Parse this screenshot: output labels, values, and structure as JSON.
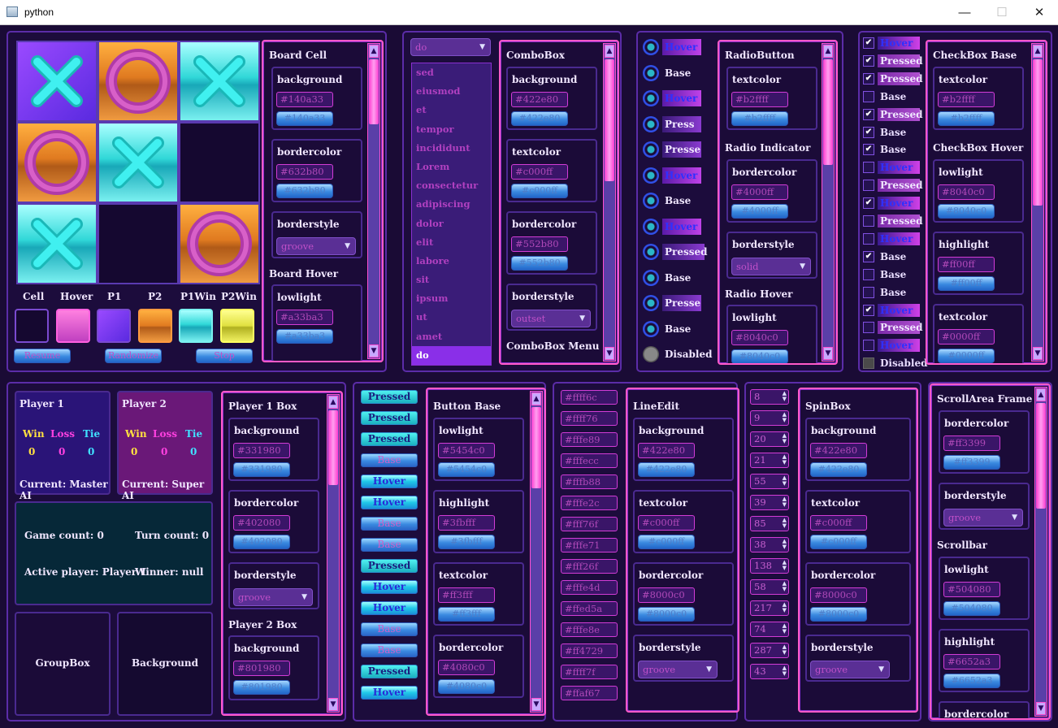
{
  "window": {
    "title": "python",
    "min": "—",
    "max": "☐",
    "close": "✕"
  },
  "board": {
    "cells": [
      "X-hover",
      "O",
      "X",
      "O",
      "X",
      "",
      "X",
      "",
      "O"
    ],
    "swatch_labels": [
      "Cell",
      "Hover",
      "P1",
      "P2",
      "P1Win",
      "P2Win"
    ],
    "buttons": [
      "Resume",
      "Randomize",
      "Stop"
    ]
  },
  "board_props": {
    "section1": "Board Cell",
    "section2": "Board Hover",
    "background": {
      "label": "background",
      "value": "#140a33"
    },
    "bordercolor": {
      "label": "bordercolor",
      "value": "#632b80"
    },
    "borderstyle": {
      "label": "borderstyle",
      "value": "groove"
    },
    "lowlight": {
      "label": "lowlight",
      "value": "#a33ba3"
    }
  },
  "combo": {
    "current": "do",
    "items": [
      "sed",
      "eiusmod",
      "et",
      "tempor",
      "incididunt",
      "Lorem",
      "consectetur",
      "adipiscing",
      "dolor",
      "elit",
      "labore",
      "sit",
      "ipsum",
      "ut",
      "amet",
      "do"
    ],
    "props": {
      "section": "ComboBox",
      "section2": "ComboBox Menu",
      "background": {
        "label": "background",
        "value": "#422e80"
      },
      "textcolor": {
        "label": "textcolor",
        "value": "#c000ff"
      },
      "bordercolor": {
        "label": "bordercolor",
        "value": "#552b80"
      },
      "borderstyle": {
        "label": "borderstyle",
        "value": "outset"
      }
    }
  },
  "radio": {
    "items": [
      {
        "label": "Hover",
        "state": "hov"
      },
      {
        "label": "Base",
        "state": "base"
      },
      {
        "label": "Hover",
        "state": "hov"
      },
      {
        "label": "Press",
        "state": "prs"
      },
      {
        "label": "Presse",
        "state": "prs"
      },
      {
        "label": "Hover",
        "state": "hov"
      },
      {
        "label": "Base",
        "state": "base"
      },
      {
        "label": "Hover",
        "state": "hov"
      },
      {
        "label": "Pressed",
        "state": "prs"
      },
      {
        "label": "Base",
        "state": "base"
      },
      {
        "label": "Presse",
        "state": "prs"
      },
      {
        "label": "Base",
        "state": "base"
      },
      {
        "label": "Disabled",
        "state": "dis"
      }
    ],
    "props": {
      "section": "RadioButton",
      "section2": "Radio Indicator",
      "section3": "Radio Hover",
      "textcolor": {
        "label": "textcolor",
        "value": "#b2ffff"
      },
      "bordercolor": {
        "label": "bordercolor",
        "value": "#4000ff"
      },
      "borderstyle": {
        "label": "borderstyle",
        "value": "solid"
      },
      "lowlight": {
        "label": "lowlight",
        "value": "#8040c0"
      }
    }
  },
  "checkbox": {
    "items": [
      {
        "label": "Hover",
        "state": "hov",
        "checked": true
      },
      {
        "label": "Pressed",
        "state": "prs",
        "checked": true
      },
      {
        "label": "Pressed",
        "state": "prs",
        "checked": true
      },
      {
        "label": "Base",
        "state": "base",
        "checked": false
      },
      {
        "label": "Pressed",
        "state": "prs",
        "checked": true
      },
      {
        "label": "Base",
        "state": "base",
        "checked": true
      },
      {
        "label": "Base",
        "state": "base",
        "checked": true
      },
      {
        "label": "Hover",
        "state": "hov",
        "checked": false
      },
      {
        "label": "Pressed",
        "state": "prs",
        "checked": false
      },
      {
        "label": "Hover",
        "state": "hov",
        "checked": true
      },
      {
        "label": "Pressed",
        "state": "prs",
        "checked": false
      },
      {
        "label": "Hover",
        "state": "hov",
        "checked": false
      },
      {
        "label": "Base",
        "state": "base",
        "checked": true
      },
      {
        "label": "Base",
        "state": "base",
        "checked": false
      },
      {
        "label": "Base",
        "state": "base",
        "checked": false
      },
      {
        "label": "Hover",
        "state": "hov",
        "checked": true
      },
      {
        "label": "Pressed",
        "state": "prs",
        "checked": false
      },
      {
        "label": "Hover",
        "state": "hov",
        "checked": false
      },
      {
        "label": "Disabled",
        "state": "dis",
        "checked": false
      }
    ],
    "props": {
      "section": "CheckBox Base",
      "section2": "CheckBox Hover",
      "textcolor": {
        "label": "textcolor",
        "value": "#b2ffff"
      },
      "lowlight": {
        "label": "lowlight",
        "value": "#8040c0"
      },
      "highlight": {
        "label": "highlight",
        "value": "#ff00ff"
      },
      "textcolor2": {
        "label": "textcolor",
        "value": "#0000ff"
      }
    }
  },
  "players": {
    "p1": {
      "name": "Player 1",
      "win": "Win",
      "loss": "Loss",
      "tie": "Tie",
      "wv": "0",
      "lv": "0",
      "tv": "0",
      "current": "Current: Master AI"
    },
    "p2": {
      "name": "Player 2",
      "win": "Win",
      "loss": "Loss",
      "tie": "Tie",
      "wv": "0",
      "lv": "0",
      "tv": "0",
      "current": "Current: Super AI"
    },
    "game_count": "Game count: 0",
    "turn_count": "Turn count: 0",
    "active": "Active player: Player 1",
    "winner": "Winner: null",
    "groupbox": "GroupBox",
    "background": "Background"
  },
  "player_props": {
    "section": "Player 1 Box",
    "section2": "Player 2 Box",
    "background": {
      "label": "background",
      "value": "#331980"
    },
    "bordercolor": {
      "label": "bordercolor",
      "value": "#402080"
    },
    "borderstyle": {
      "label": "borderstyle",
      "value": "groove"
    },
    "background2": {
      "label": "background",
      "value": "#801980"
    }
  },
  "buttons": {
    "items": [
      {
        "label": "Pressed",
        "state": "pressed"
      },
      {
        "label": "Pressed",
        "state": "pressed"
      },
      {
        "label": "Pressed",
        "state": "pressed"
      },
      {
        "label": "Base",
        "state": "base"
      },
      {
        "label": "Hover",
        "state": "hover"
      },
      {
        "label": "Hover",
        "state": "hover"
      },
      {
        "label": "Base",
        "state": "base"
      },
      {
        "label": "Base",
        "state": "base"
      },
      {
        "label": "Pressed",
        "state": "pressed"
      },
      {
        "label": "Hover",
        "state": "hover"
      },
      {
        "label": "Hover",
        "state": "hover"
      },
      {
        "label": "Base",
        "state": "base"
      },
      {
        "label": "Base",
        "state": "base"
      },
      {
        "label": "Pressed",
        "state": "pressed"
      },
      {
        "label": "Hover",
        "state": "hover"
      }
    ],
    "props": {
      "section": "Button Base",
      "lowlight": {
        "label": "lowlight",
        "value": "#5454c0"
      },
      "highlight": {
        "label": "highlight",
        "value": "#3fbfff"
      },
      "textcolor": {
        "label": "textcolor",
        "value": "#ff3fff"
      },
      "bordercolor": {
        "label": "bordercolor",
        "value": "#4080c0"
      }
    }
  },
  "lineedit": {
    "items": [
      "#ffff6c",
      "#ffff76",
      "#fffe89",
      "#fffecc",
      "#fffb88",
      "#fffe2c",
      "#fff76f",
      "#fffe71",
      "#fff26f",
      "#fffe4d",
      "#ffed5a",
      "#fffe8e",
      "#ff4729",
      "#ffff7f",
      "#ffaf67"
    ],
    "props": {
      "section": "LineEdit",
      "background": {
        "label": "background",
        "value": "#422e80"
      },
      "textcolor": {
        "label": "textcolor",
        "value": "#c000ff"
      },
      "bordercolor": {
        "label": "bordercolor",
        "value": "#8000c0"
      },
      "borderstyle": {
        "label": "borderstyle",
        "value": "groove"
      }
    }
  },
  "spinbox": {
    "items": [
      "8",
      "9",
      "20",
      "21",
      "55",
      "39",
      "85",
      "38",
      "138",
      "58",
      "217",
      "74",
      "287",
      "43"
    ],
    "props": {
      "section": "SpinBox",
      "background": {
        "label": "background",
        "value": "#422e80"
      },
      "textcolor": {
        "label": "textcolor",
        "value": "#c000ff"
      },
      "bordercolor": {
        "label": "bordercolor",
        "value": "#8000c0"
      },
      "borderstyle": {
        "label": "borderstyle",
        "value": "groove"
      }
    }
  },
  "scrollarea": {
    "section": "ScrollArea Frame",
    "section2": "Scrollbar",
    "bordercolor": {
      "label": "bordercolor",
      "value": "#ff3399"
    },
    "borderstyle": {
      "label": "borderstyle",
      "value": "groove"
    },
    "lowlight": {
      "label": "lowlight",
      "value": "#504080"
    },
    "highlight": {
      "label": "highlight",
      "value": "#6652a3"
    },
    "bordercolor2": {
      "label": "bordercolor",
      "value": ""
    }
  }
}
